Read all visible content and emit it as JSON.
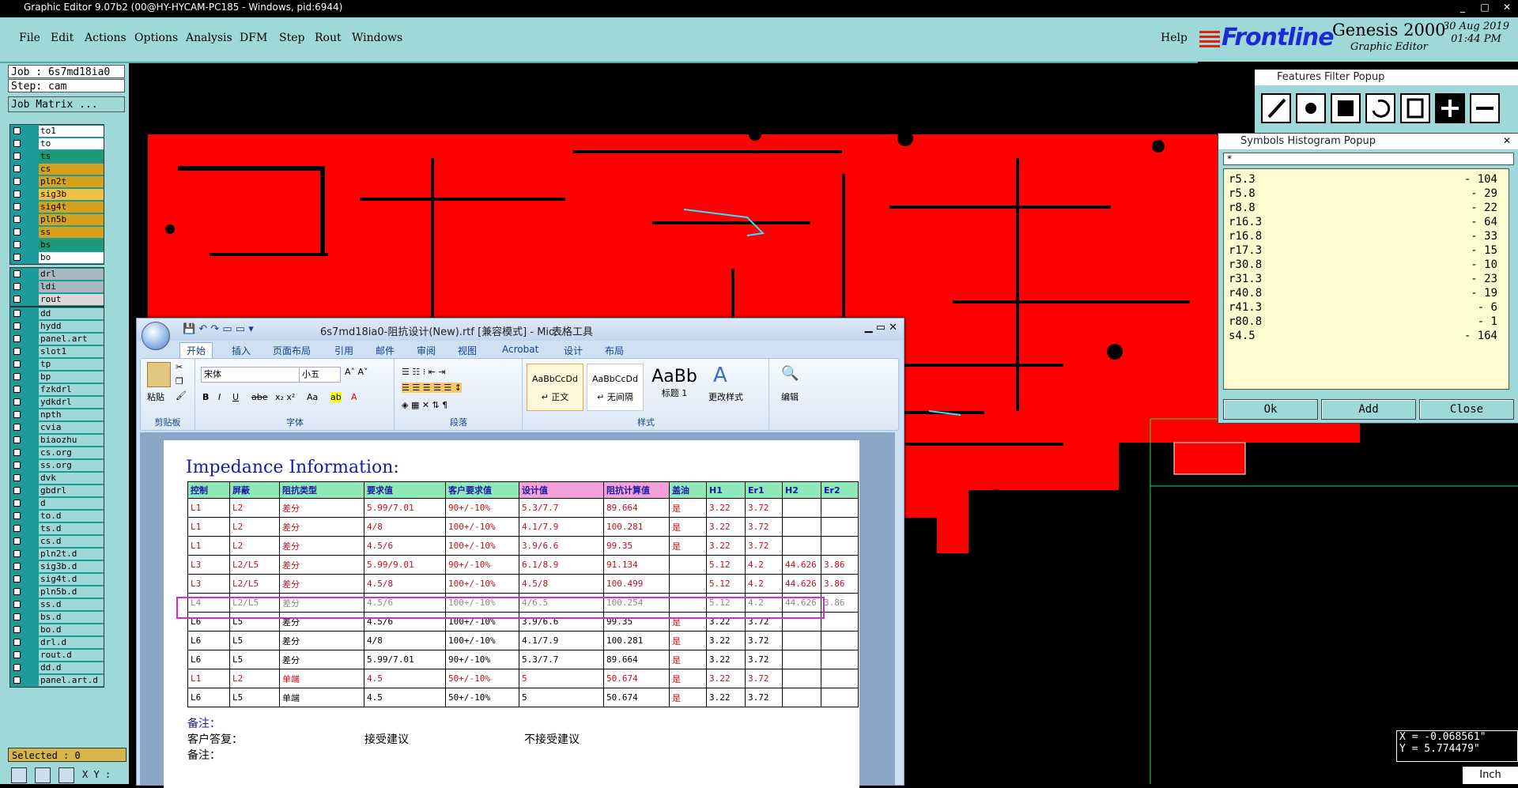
{
  "window": {
    "title": "Graphic Editor 9.07b2 (00@HY-HYCAM-PC185 - Windows, pid:6944)"
  },
  "menu": {
    "items": [
      "File",
      "Edit",
      "Actions",
      "Options",
      "Analysis",
      "DFM",
      "Step",
      "Rout",
      "Windows"
    ],
    "help": "Help"
  },
  "logo": {
    "brand": "Frontline",
    "product": "Genesis 2000",
    "sub": "Graphic Editor",
    "date": "30 Aug 2019",
    "time": "01:44 PM"
  },
  "job": {
    "job_line": "Job : 6s7md18ia0",
    "step_line": "Step: cam",
    "matrix_button": "Job Matrix ..."
  },
  "layers_group1": [
    {
      "name": "to1",
      "color": "#ffffff"
    },
    {
      "name": "to",
      "color": "#ffffff"
    },
    {
      "name": "ts",
      "color": "#1d9a7a"
    },
    {
      "name": "cs",
      "color": "#d6a21a"
    },
    {
      "name": "pln2t",
      "color": "#d6a21a"
    },
    {
      "name": "sig3b",
      "color": "#f0c040"
    },
    {
      "name": "sig4t",
      "color": "#d6a21a"
    },
    {
      "name": "pln5b",
      "color": "#d6a21a"
    },
    {
      "name": "ss",
      "color": "#d6a21a"
    },
    {
      "name": "bs",
      "color": "#1d9a7a"
    },
    {
      "name": "bo",
      "color": "#ffffff"
    }
  ],
  "layers_group2": [
    {
      "name": "drl",
      "color": "#a8b8c0"
    },
    {
      "name": "ldi",
      "color": "#a8b8c0"
    },
    {
      "name": "rout",
      "color": "#d8d8d8"
    }
  ],
  "layers_group3": [
    "dd",
    "hydd",
    "panel.art",
    "slot1",
    "tp",
    "bp",
    "fzkdrl",
    "ydkdrl",
    "npth",
    "cvia",
    "biaozhu",
    "cs.org",
    "ss.org",
    "dvk",
    "gbdrl",
    "d",
    "to.d",
    "ts.d",
    "cs.d",
    "pln2t.d",
    "sig3b.d",
    "sig4t.d",
    "pln5b.d",
    "ss.d",
    "bs.d",
    "bo.d",
    "drl.d",
    "rout.d",
    "dd.d",
    "panel.art.d"
  ],
  "selected": "Selected : 0",
  "word": {
    "title": "6s7md18ia0-阻抗设计(New).rtf [兼容模式] - Mic...",
    "context_tab": "表格工具",
    "tabs": [
      "开始",
      "插入",
      "页面布局",
      "引用",
      "邮件",
      "审阅",
      "视图",
      "Acrobat",
      "设计",
      "布局"
    ],
    "groups": [
      "剪贴板",
      "字体",
      "段落",
      "样式"
    ],
    "font_name": "宋体",
    "font_size": "小五",
    "paste": "粘贴",
    "edit": "编辑",
    "change_styles": "更改样式",
    "styles": [
      {
        "preview": "AaBbCcDd",
        "name": "↵ 正文"
      },
      {
        "preview": "AaBbCcDd",
        "name": "↵ 无间隔"
      },
      {
        "preview": "AaBb",
        "name": "标题 1"
      }
    ],
    "heading": "Impedance Information:",
    "columns": [
      "控制",
      "屏蔽",
      "阻抗类型",
      "要求值",
      "客户要求值",
      "设计值",
      "阻抗计算值",
      "盖油",
      "H1",
      "Er1",
      "H2",
      "Er2"
    ],
    "rows": [
      [
        "L1",
        "L2",
        "差分",
        "5.99/7.01",
        "90+/-10%",
        "5.3/7.7",
        "89.664",
        "是",
        "3.22",
        "3.72",
        "",
        ""
      ],
      [
        "L1",
        "L2",
        "差分",
        "4/8",
        "100+/-10%",
        "4.1/7.9",
        "100.281",
        "是",
        "3.22",
        "3.72",
        "",
        ""
      ],
      [
        "L1",
        "L2",
        "差分",
        "4.5/6",
        "100+/-10%",
        "3.9/6.6",
        "99.35",
        "是",
        "3.22",
        "3.72",
        "",
        ""
      ],
      [
        "L3",
        "L2/L5",
        "差分",
        "5.99/9.01",
        "90+/-10%",
        "6.1/8.9",
        "91.134",
        "",
        "5.12",
        "4.2",
        "44.626",
        "3.86"
      ],
      [
        "L3",
        "L2/L5",
        "差分",
        "4.5/8",
        "100+/-10%",
        "4.5/8",
        "100.499",
        "",
        "5.12",
        "4.2",
        "44.626",
        "3.86"
      ],
      [
        "L4",
        "L2/L5",
        "差分",
        "4.5/6",
        "100+/-10%",
        "4/6.5",
        "100.254",
        "",
        "5.12",
        "4.2",
        "44.626",
        "3.86"
      ],
      [
        "L6",
        "L5",
        "差分",
        "4.5/6",
        "100+/-10%",
        "3.9/6.6",
        "99.35",
        "是",
        "3.22",
        "3.72",
        "",
        ""
      ],
      [
        "L6",
        "L5",
        "差分",
        "4/8",
        "100+/-10%",
        "4.1/7.9",
        "100.281",
        "是",
        "3.22",
        "3.72",
        "",
        ""
      ],
      [
        "L6",
        "L5",
        "差分",
        "5.99/7.01",
        "90+/-10%",
        "5.3/7.7",
        "89.664",
        "是",
        "3.22",
        "3.72",
        "",
        ""
      ],
      [
        "L1",
        "L2",
        "单端",
        "4.5",
        "50+/-10%",
        "5",
        "50.674",
        "是",
        "3.22",
        "3.72",
        "",
        ""
      ],
      [
        "L6",
        "L5",
        "单端",
        "4.5",
        "50+/-10%",
        "5",
        "50.674",
        "是",
        "3.22",
        "3.72",
        "",
        ""
      ]
    ],
    "notes": {
      "remark1": "备注：",
      "reply": "客户答复：",
      "accept": "接受建议",
      "reject": "不接受建议",
      "remark2": "备注："
    }
  },
  "features_filter": {
    "title": "Features Filter Popup"
  },
  "histogram": {
    "title": "Symbols Histogram Popup",
    "filter": "*",
    "items": [
      {
        "sym": "r5.3",
        "count": "- 104"
      },
      {
        "sym": "r5.8",
        "count": "- 29"
      },
      {
        "sym": "r8.8",
        "count": "- 22"
      },
      {
        "sym": "r16.3",
        "count": "- 64"
      },
      {
        "sym": "r16.8",
        "count": "- 33"
      },
      {
        "sym": "r17.3",
        "count": "- 15"
      },
      {
        "sym": "r30.8",
        "count": "- 10"
      },
      {
        "sym": "r31.3",
        "count": "- 23"
      },
      {
        "sym": "r40.8",
        "count": "- 19"
      },
      {
        "sym": "r41.3",
        "count": "- 6"
      },
      {
        "sym": "r80.8",
        "count": "- 1"
      },
      {
        "sym": "s4.5",
        "count": "- 164"
      }
    ],
    "buttons": [
      "Ok",
      "Add",
      "Close"
    ]
  },
  "coords": {
    "x": "X = -0.068561\"",
    "y": "Y = 5.774479\""
  },
  "units": "Inch",
  "xy_label": "X Y :"
}
